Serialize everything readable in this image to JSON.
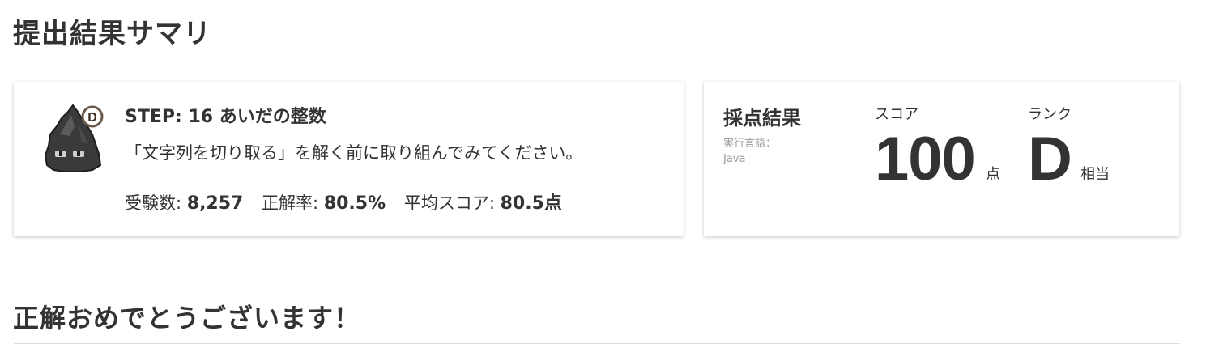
{
  "page": {
    "title": "提出結果サマリ",
    "congrats": "正解おめでとうございます！"
  },
  "problem": {
    "rank_badge": "D",
    "step_title": "STEP: 16 あいだの整数",
    "description": "「文字列を切り取る」を解く前に取り組んでみてください。",
    "stats": {
      "attempts_label": "受験数:",
      "attempts_value": "8,257",
      "correct_rate_label": "正解率:",
      "correct_rate_value": "80.5%",
      "avg_score_label": "平均スコア:",
      "avg_score_value": "80.5点"
    }
  },
  "result": {
    "title": "採点結果",
    "language_label": "実行言語：",
    "language_value": "Java",
    "score_label": "スコア",
    "score_value": "100",
    "score_unit": "点",
    "rank_label": "ランク",
    "rank_value": "D",
    "rank_unit": "相当"
  },
  "colors": {
    "text": "#333333",
    "muted": "#999999",
    "card_bg": "#ffffff",
    "divider": "#dddddd"
  }
}
